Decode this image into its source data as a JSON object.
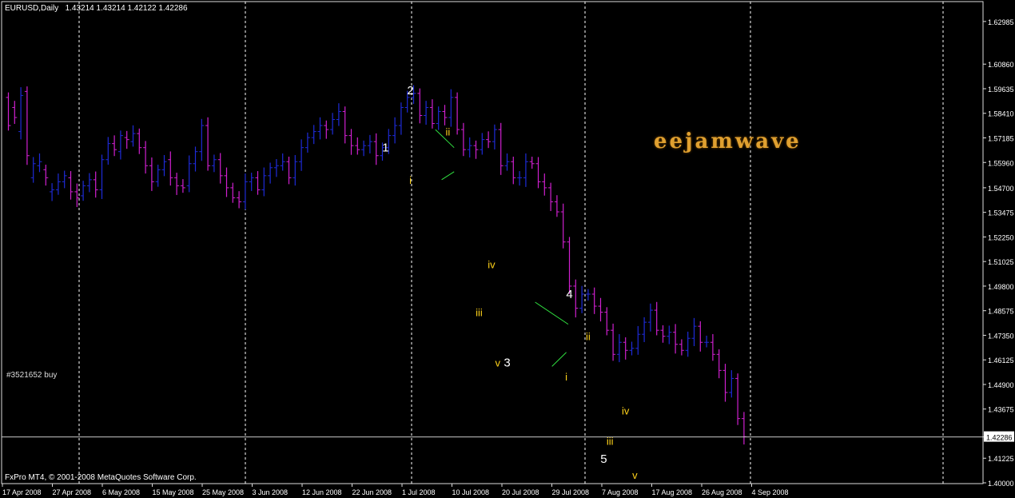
{
  "header": {
    "symbol_timeframe": "EURUSD,Daily",
    "open": "1.43214",
    "high": "1.43214",
    "low": "1.42122",
    "close": "1.42286"
  },
  "footer": {
    "copyright": "FxPro MT4, © 2001-2008 MetaQuotes Software Corp."
  },
  "order_label": "#3521652 buy",
  "brand_logo": "eejamwave",
  "colors": {
    "background": "#000000",
    "bull": "#1e2bd8",
    "bear": "#d020d0",
    "grid": "#ffffff",
    "wave_main": "#ffffff",
    "wave_minor": "#ffd21a",
    "trendline": "#30e040",
    "brand": "#e0a030"
  },
  "chart_data": {
    "type": "ohlc",
    "symbol": "EURUSD",
    "timeframe": "Daily",
    "ylim": [
      1.4,
      1.629
    ],
    "y_ticks": [
      "1.62985",
      "1.60860",
      "1.59635",
      "1.58410",
      "1.57185",
      "1.55960",
      "1.54700",
      "1.53475",
      "1.52250",
      "1.51025",
      "1.49800",
      "1.48575",
      "1.47350",
      "1.46125",
      "1.44900",
      "1.43675",
      "1.42286",
      "1.41225",
      "1.40000"
    ],
    "x_ticks": [
      "17 Apr 2008",
      "27 Apr 2008",
      "6 May 2008",
      "15 May 2008",
      "25 May 2008",
      "3 Jun 2008",
      "12 Jun 2008",
      "22 Jun 2008",
      "1 Jul 2008",
      "10 Jul 2008",
      "20 Jul 2008",
      "29 Jul 2008",
      "7 Aug 2008",
      "17 Aug 2008",
      "26 Aug 2008",
      "4 Sep 2008"
    ],
    "current_price": {
      "label": "1.42286",
      "value": 1.42286
    },
    "close_path": [
      [
        1.592,
        1.578
      ],
      [
        1.587,
        1.582
      ],
      [
        1.575,
        1.593
      ],
      [
        1.595,
        1.563
      ],
      [
        1.552,
        1.559
      ],
      [
        1.558,
        1.56
      ],
      [
        1.556,
        1.552
      ],
      [
        1.545,
        1.546
      ],
      [
        1.546,
        1.55
      ],
      [
        1.55,
        1.553
      ],
      [
        1.552,
        1.545
      ],
      [
        1.545,
        1.542
      ],
      [
        1.543,
        1.548
      ],
      [
        1.548,
        1.551
      ],
      [
        1.551,
        1.546
      ],
      [
        1.546,
        1.561
      ],
      [
        1.561,
        1.569
      ],
      [
        1.569,
        1.566
      ],
      [
        1.565,
        1.573
      ],
      [
        1.572,
        1.571
      ],
      [
        1.57,
        1.574
      ],
      [
        1.574,
        1.567
      ],
      [
        1.567,
        1.558
      ],
      [
        1.558,
        1.55
      ],
      [
        1.55,
        1.556
      ],
      [
        1.556,
        1.56
      ],
      [
        1.561,
        1.552
      ],
      [
        1.552,
        1.548
      ],
      [
        1.548,
        1.547
      ],
      [
        1.548,
        1.559
      ],
      [
        1.559,
        1.565
      ],
      [
        1.565,
        1.578
      ],
      [
        1.578,
        1.558
      ],
      [
        1.558,
        1.561
      ],
      [
        1.561,
        1.553
      ],
      [
        1.553,
        1.547
      ],
      [
        1.547,
        1.542
      ],
      [
        1.542,
        1.54
      ],
      [
        1.54,
        1.55
      ],
      [
        1.55,
        1.552
      ],
      [
        1.552,
        1.546
      ],
      [
        1.546,
        1.553
      ],
      [
        1.553,
        1.557
      ],
      [
        1.557,
        1.558
      ],
      [
        1.558,
        1.56
      ],
      [
        1.56,
        1.552
      ],
      [
        1.552,
        1.56
      ],
      [
        1.56,
        1.567
      ],
      [
        1.567,
        1.572
      ],
      [
        1.572,
        1.575
      ],
      [
        1.575,
        1.578
      ],
      [
        1.578,
        1.576
      ],
      [
        1.576,
        1.581
      ],
      [
        1.581,
        1.585
      ],
      [
        1.585,
        1.573
      ],
      [
        1.573,
        1.568
      ],
      [
        1.568,
        1.566
      ],
      [
        1.566,
        1.568
      ],
      [
        1.568,
        1.57
      ],
      [
        1.57,
        1.563
      ],
      [
        1.563,
        1.567
      ],
      [
        1.567,
        1.573
      ],
      [
        1.573,
        1.578
      ],
      [
        1.578,
        1.587
      ],
      [
        1.587,
        1.592
      ],
      [
        1.592,
        1.594
      ],
      [
        1.594,
        1.583
      ],
      [
        1.583,
        1.587
      ],
      [
        1.587,
        1.579
      ],
      [
        1.579,
        1.585
      ],
      [
        1.585,
        1.582
      ],
      [
        1.582,
        1.592
      ],
      [
        1.592,
        1.576
      ],
      [
        1.576,
        1.566
      ],
      [
        1.566,
        1.568
      ],
      [
        1.568,
        1.566
      ],
      [
        1.566,
        1.571
      ],
      [
        1.571,
        1.57
      ],
      [
        1.57,
        1.576
      ],
      [
        1.576,
        1.558
      ],
      [
        1.558,
        1.56
      ],
      [
        1.56,
        1.552
      ],
      [
        1.552,
        1.552
      ],
      [
        1.552,
        1.56
      ],
      [
        1.56,
        1.559
      ],
      [
        1.559,
        1.55
      ],
      [
        1.55,
        1.547
      ],
      [
        1.547,
        1.54
      ],
      [
        1.54,
        1.535
      ],
      [
        1.535,
        1.52
      ],
      [
        1.52,
        1.498
      ],
      [
        1.498,
        1.487
      ],
      [
        1.487,
        1.494
      ],
      [
        1.494,
        1.494
      ],
      [
        1.494,
        1.488
      ],
      [
        1.488,
        1.485
      ],
      [
        1.485,
        1.476
      ],
      [
        1.476,
        1.464
      ],
      [
        1.464,
        1.47
      ],
      [
        1.47,
        1.466
      ],
      [
        1.466,
        1.467
      ],
      [
        1.467,
        1.474
      ],
      [
        1.474,
        1.48
      ],
      [
        1.48,
        1.486
      ],
      [
        1.486,
        1.476
      ],
      [
        1.476,
        1.473
      ],
      [
        1.473,
        1.475
      ],
      [
        1.475,
        1.469
      ],
      [
        1.469,
        1.466
      ],
      [
        1.466,
        1.472
      ],
      [
        1.472,
        1.478
      ],
      [
        1.478,
        1.47
      ],
      [
        1.47,
        1.47
      ],
      [
        1.47,
        1.464
      ],
      [
        1.464,
        1.456
      ],
      [
        1.456,
        1.445
      ],
      [
        1.445,
        1.452
      ],
      [
        1.452,
        1.432
      ],
      [
        1.432,
        1.423
      ]
    ],
    "wave_labels": [
      {
        "text": "1",
        "t": 60.5,
        "price": 1.565,
        "level": "main"
      },
      {
        "text": "2",
        "t": 64.5,
        "price": 1.5935,
        "level": "main"
      },
      {
        "text": "i",
        "t": 64.5,
        "price": 1.549,
        "level": "minor"
      },
      {
        "text": "ii",
        "t": 70.5,
        "price": 1.573,
        "level": "minor"
      },
      {
        "text": "iv",
        "t": 77.5,
        "price": 1.507,
        "level": "minor"
      },
      {
        "text": "iii",
        "t": 75.5,
        "price": 1.483,
        "level": "minor"
      },
      {
        "text": "v",
        "t": 78.5,
        "price": 1.458,
        "level": "minor"
      },
      {
        "text": "3",
        "t": 80.0,
        "price": 1.458,
        "level": "main"
      },
      {
        "text": "4",
        "t": 90.0,
        "price": 1.492,
        "level": "main"
      },
      {
        "text": "ii",
        "t": 93.0,
        "price": 1.471,
        "level": "minor"
      },
      {
        "text": "i",
        "t": 89.5,
        "price": 1.451,
        "level": "minor"
      },
      {
        "text": "iv",
        "t": 99.0,
        "price": 1.434,
        "level": "minor"
      },
      {
        "text": "iii",
        "t": 96.5,
        "price": 1.419,
        "level": "minor"
      },
      {
        "text": "5",
        "t": 95.5,
        "price": 1.41,
        "level": "main"
      },
      {
        "text": "v",
        "t": 100.5,
        "price": 1.402,
        "level": "minor"
      }
    ],
    "trendlines": [
      [
        [
          68.5,
          1.576
        ],
        [
          71.5,
          1.567
        ]
      ],
      [
        [
          69.5,
          1.551
        ],
        [
          71.5,
          1.555
        ]
      ],
      [
        [
          84.5,
          1.49
        ],
        [
          89.8,
          1.479
        ]
      ],
      [
        [
          87.2,
          1.458
        ],
        [
          89.5,
          1.465
        ]
      ]
    ],
    "grid": "vertical-dashed",
    "legend": "none"
  }
}
